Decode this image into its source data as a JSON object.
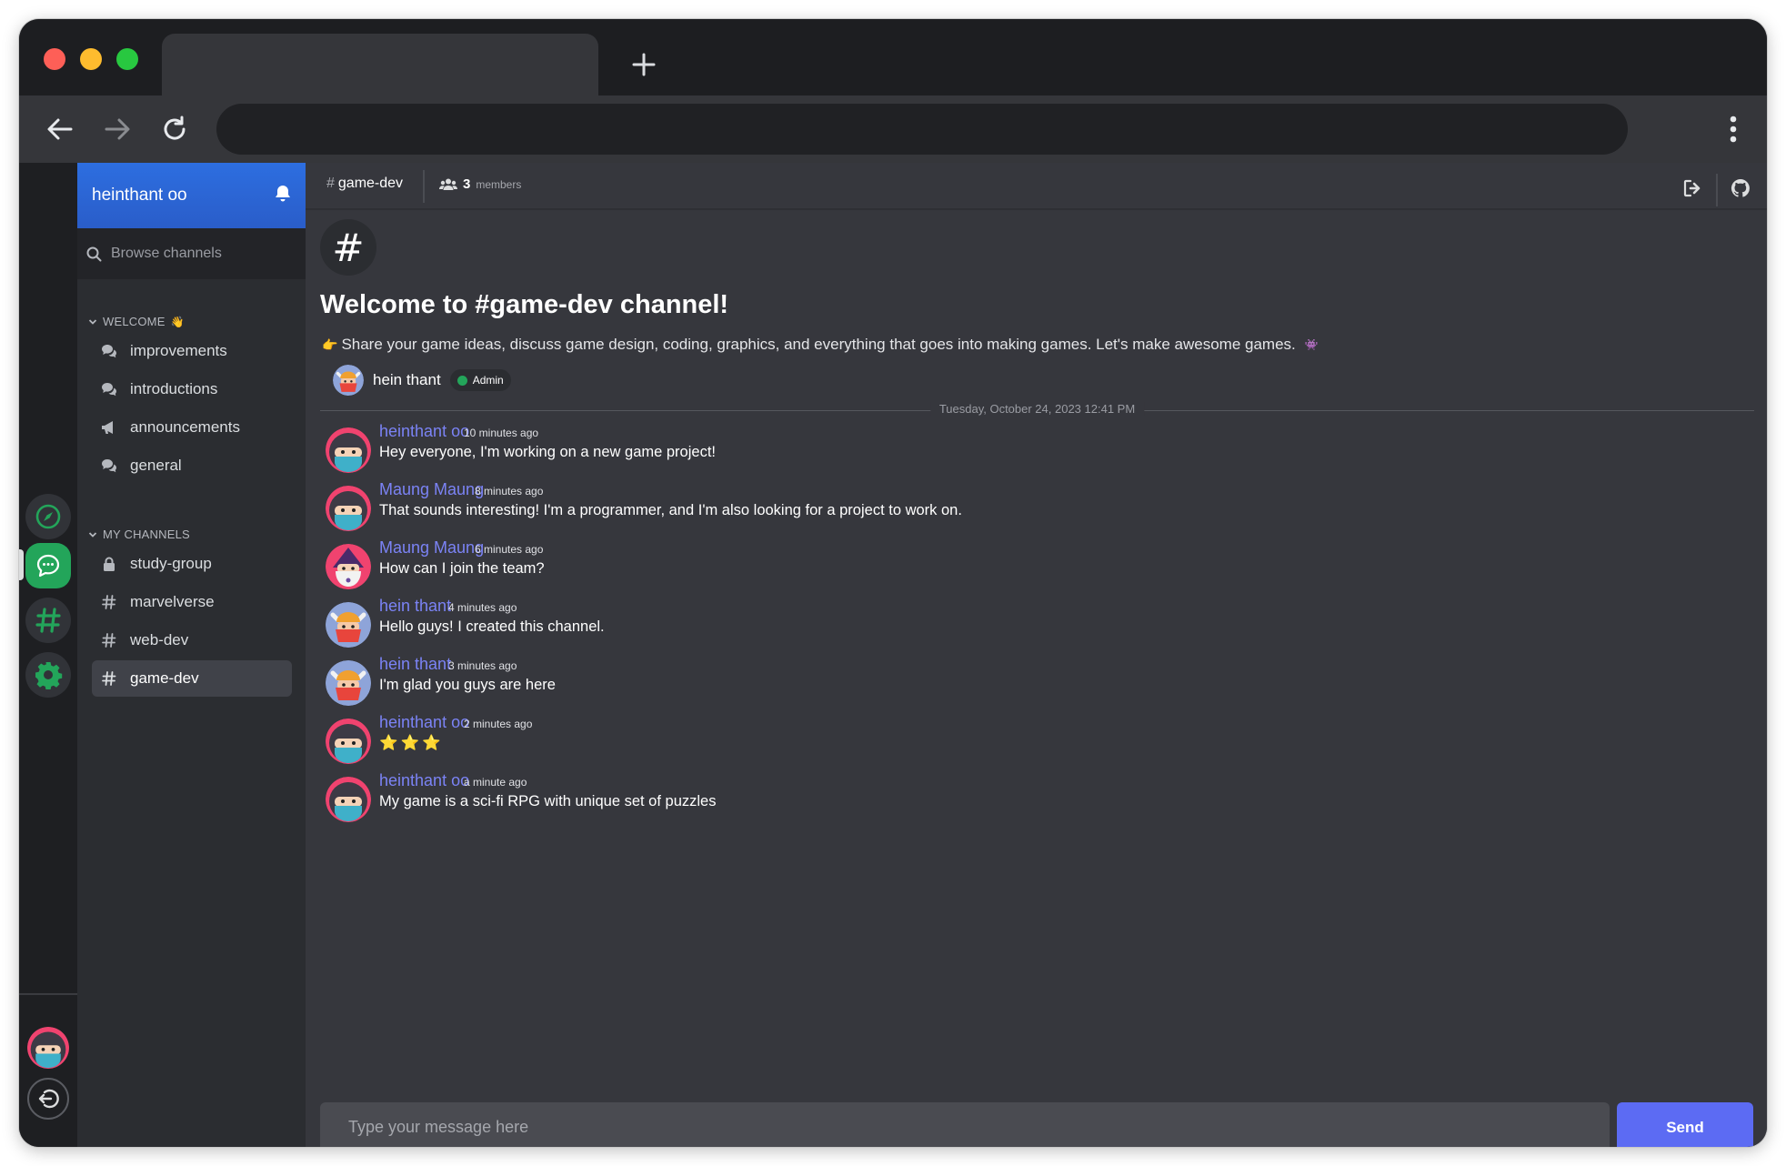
{
  "browser": {
    "new_tab_icon": "plus-icon",
    "back_icon": "arrow-left-icon",
    "forward_icon": "arrow-right-icon",
    "reload_icon": "reload-icon",
    "menu_icon": "kebab-menu-icon",
    "address": ""
  },
  "rail": {
    "items": [
      {
        "name": "explore",
        "icon": "compass-icon"
      },
      {
        "name": "chat",
        "icon": "chat-bubble-icon",
        "active": true
      },
      {
        "name": "channels",
        "icon": "hashtag-icon"
      },
      {
        "name": "settings",
        "icon": "gear-icon"
      }
    ],
    "logout_icon": "logout-icon"
  },
  "sidebar": {
    "user_name": "heinthant oo",
    "bell_icon": "bell-icon",
    "search_placeholder": "Browse channels",
    "sections": [
      {
        "title": "WELCOME",
        "emoji": "👋",
        "channels": [
          {
            "label": "improvements",
            "icon": "chat-bubbles-icon"
          },
          {
            "label": "introductions",
            "icon": "chat-bubbles-icon"
          },
          {
            "label": "announcements",
            "icon": "megaphone-icon"
          },
          {
            "label": "general",
            "icon": "chat-bubbles-icon"
          }
        ]
      },
      {
        "title": "MY CHANNELS",
        "channels": [
          {
            "label": "study-group",
            "icon": "lock-icon"
          },
          {
            "label": "marvelverse",
            "icon": "hashtag-icon"
          },
          {
            "label": "web-dev",
            "icon": "hashtag-icon"
          },
          {
            "label": "game-dev",
            "icon": "hashtag-icon",
            "active": true
          }
        ]
      }
    ]
  },
  "channel": {
    "hash": "#",
    "name": "game-dev",
    "member_count": "3",
    "member_label": "members",
    "welcome_hash": "#",
    "welcome_title": "Welcome to #game-dev channel!",
    "description_lead": "👉",
    "description": "Share your game ideas, discuss game design, coding, graphics, and everything that goes into making games. Let's make awesome games.",
    "description_trail": "👾",
    "owner_name": "hein thant",
    "owner_badge": "Admin",
    "date_divider": "Tuesday, October 24, 2023 12:41 PM"
  },
  "messages": [
    {
      "author": "heinthant oo",
      "time": "10 minutes ago",
      "text": "Hey everyone, I'm working on a new game project!",
      "avatar": "ninja-avatar"
    },
    {
      "author": "Maung Maung",
      "time": "8 minutes ago",
      "text": "That sounds interesting! I'm a programmer, and I'm also looking for a project to work on.",
      "avatar": "ninja-avatar"
    },
    {
      "author": "Maung Maung",
      "time": "6 minutes ago",
      "text": "How can I join the team?",
      "avatar": "wizard-avatar"
    },
    {
      "author": "hein thant",
      "time": "4 minutes ago",
      "text": "Hello guys! I created this channel.",
      "avatar": "viking-avatar"
    },
    {
      "author": "hein thant",
      "time": "3 minutes ago",
      "text": "I'm glad you guys are here",
      "avatar": "viking-avatar"
    },
    {
      "author": "heinthant oo",
      "time": "2 minutes ago",
      "text": "⭐⭐⭐",
      "avatar": "ninja-avatar"
    },
    {
      "author": "heinthant oo",
      "time": "a minute ago",
      "text": "My game is a sci-fi RPG with unique set of puzzles",
      "avatar": "ninja-avatar"
    }
  ],
  "composer": {
    "placeholder": "Type your message here",
    "value": "",
    "send_label": "Send"
  },
  "colors": {
    "accent": "#5c6bf3",
    "author": "#7b83f5",
    "active_green": "#23a55a",
    "user_header": "#2d6ee0"
  }
}
